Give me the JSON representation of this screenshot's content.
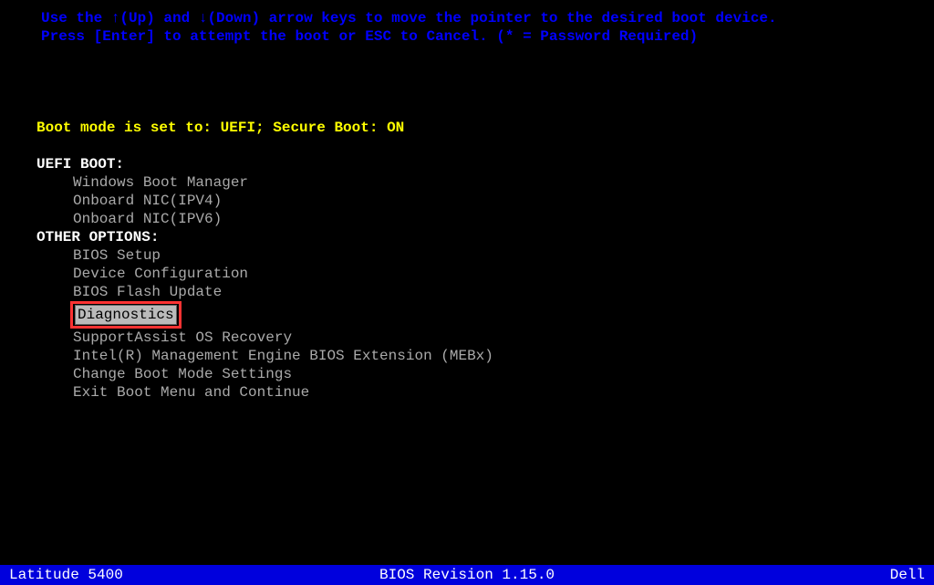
{
  "instructions": {
    "line1_part1": "Use the ",
    "line1_up": "↑(Up)",
    "line1_part2": " and ",
    "line1_down": "↓(Down)",
    "line1_part3": " arrow keys to move the pointer to the desired boot device.",
    "line2": "Press [Enter] to attempt the boot or ESC to Cancel. (* = Password Required)"
  },
  "boot_mode": "Boot mode is set to: UEFI; Secure Boot: ON",
  "uefi_boot": {
    "header": "UEFI BOOT:",
    "items": [
      "Windows Boot Manager",
      "Onboard NIC(IPV4)",
      "Onboard NIC(IPV6)"
    ]
  },
  "other_options": {
    "header": "OTHER OPTIONS:",
    "items_before": [
      "BIOS Setup",
      "Device Configuration",
      "BIOS Flash Update"
    ],
    "selected": "Diagnostics",
    "items_after": [
      "SupportAssist OS Recovery",
      "Intel(R) Management Engine BIOS Extension (MEBx)",
      "Change Boot Mode Settings",
      "Exit Boot Menu and Continue"
    ]
  },
  "status_bar": {
    "model": "Latitude 5400",
    "bios_revision": "BIOS Revision 1.15.0",
    "vendor": "Dell"
  }
}
